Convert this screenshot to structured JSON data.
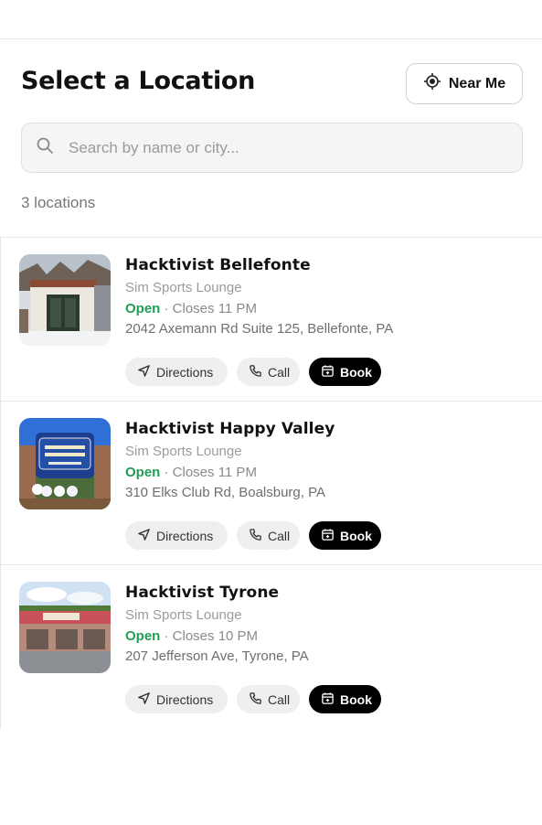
{
  "header": {
    "title": "Select a Location",
    "near_me_label": "Near Me"
  },
  "search": {
    "placeholder": "Search by name or city...",
    "value": ""
  },
  "results": {
    "count_label": "3 locations"
  },
  "locations": [
    {
      "name": "Hacktivist Bellefonte",
      "type": "Sim Sports Lounge",
      "status": "Open",
      "closes": "· Closes 11 PM",
      "address": "2042 Axemann Rd Suite 125, Bellefonte, PA"
    },
    {
      "name": "Hacktivist Happy Valley",
      "type": "Sim Sports Lounge",
      "status": "Open",
      "closes": "· Closes 11 PM",
      "address": "310 Elks Club Rd, Boalsburg, PA"
    },
    {
      "name": "Hacktivist Tyrone",
      "type": "Sim Sports Lounge",
      "status": "Open",
      "closes": "· Closes 10 PM",
      "address": "207 Jefferson Ave, Tyrone, PA"
    }
  ],
  "actions": {
    "directions_label": "Directions",
    "call_label": "Call",
    "book_label": "Book"
  },
  "colors": {
    "open_status": "#1f9d55",
    "book_button": "#000000"
  },
  "icons": {
    "near_me": "crosshair-icon",
    "search": "search-icon",
    "directions": "navigation-arrow-icon",
    "call": "phone-icon",
    "book": "calendar-icon"
  }
}
